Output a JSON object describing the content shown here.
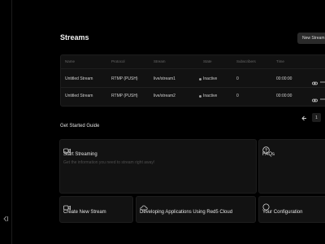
{
  "header": {
    "title": "Streams",
    "new_button": "New Stream"
  },
  "table": {
    "columns": [
      "Name",
      "Protocol",
      "Stream",
      "State",
      "Subscribers",
      "Time"
    ],
    "rows": [
      {
        "name": "Untitled Stream",
        "protocol": "RTMP (PUSH)",
        "stream": "live/stream1",
        "state": "Inactive",
        "subscribers": "0",
        "time": "00:00:00"
      },
      {
        "name": "Untitled Stream",
        "protocol": "RTMP (PUSH)",
        "stream": "live/stream2",
        "state": "Inactive",
        "subscribers": "0",
        "time": "00:00:00"
      }
    ]
  },
  "pagination": {
    "current_page": "1"
  },
  "guide": {
    "title": "Get Started Guide",
    "cards": {
      "start_streaming": {
        "title": "Start Streaming",
        "subtitle": "Get the information you need to stream right away!"
      },
      "faqs": {
        "title": "FAQs"
      },
      "create_stream": {
        "title": "Create New Stream"
      },
      "developing": {
        "title": "Developing Applications Using Red5 Cloud"
      },
      "configuration": {
        "title": "Your Configuration"
      }
    }
  },
  "icons": [
    "video-icon",
    "question-icon",
    "cloud-icon",
    "circle-icon",
    "link-icon",
    "more-icon",
    "chevron-left-icon",
    "sidebar-collapse-icon"
  ],
  "colors": {
    "background": "#000000",
    "card": "#121212",
    "inactive_dot": "#9a9a9a"
  }
}
